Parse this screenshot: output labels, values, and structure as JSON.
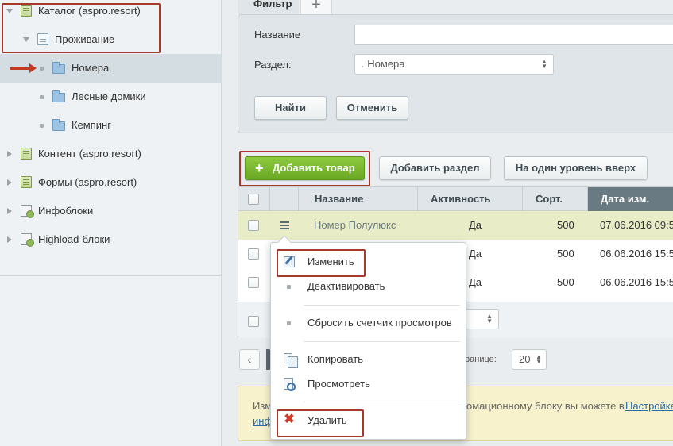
{
  "sidebar": {
    "items": [
      {
        "label": "Каталог (aspro.resort)"
      },
      {
        "label": "Проживание"
      },
      {
        "label": "Номера"
      },
      {
        "label": "Лесные домики"
      },
      {
        "label": "Кемпинг"
      },
      {
        "label": "Контент (aspro.resort)"
      },
      {
        "label": "Формы (aspro.resort)"
      },
      {
        "label": "Инфоблоки"
      },
      {
        "label": "Highload-блоки"
      }
    ]
  },
  "filter": {
    "tab_label": "Фильтр",
    "add_tab": "+",
    "name_label": "Название",
    "name_value": "",
    "section_label": "Раздел:",
    "section_value": ". Номера",
    "find_button": "Найти",
    "cancel_button": "Отменить"
  },
  "toolbar": {
    "add_product": "Добавить товар",
    "add_section": "Добавить раздел",
    "level_up": "На один уровень вверх"
  },
  "table": {
    "columns": [
      "Название",
      "Активность",
      "Сорт.",
      "Дата изм."
    ],
    "rows": [
      {
        "name": "Номер Полулюкс",
        "active": "Да",
        "sort": "500",
        "date": "07.06.2016 09:5"
      },
      {
        "name": "",
        "active": "Да",
        "sort": "500",
        "date": "06.06.2016 15:5"
      },
      {
        "name": "",
        "active": "Да",
        "sort": "500",
        "date": "06.06.2016 15:5"
      }
    ]
  },
  "pagination": {
    "prev": "‹",
    "per_page_label": "транице:",
    "per_page_value": "20"
  },
  "note": {
    "line1_start": "Изм",
    "line1_mid": "омационному блоку вы можете в",
    "line1_link": "Настройка",
    "line2_link": "инф"
  },
  "context_menu": {
    "items": [
      {
        "label": "Изменить",
        "icon": "edit-icon"
      },
      {
        "label": "Деактивировать",
        "icon": "bullet"
      },
      {
        "label": "Сбросить счетчик просмотров",
        "icon": "bullet"
      },
      {
        "label": "Копировать",
        "icon": "copy-icon"
      },
      {
        "label": "Просмотреть",
        "icon": "view-icon"
      },
      {
        "label": "Удалить",
        "icon": "delete-icon"
      }
    ]
  },
  "colors": {
    "accent_green": "#6aa824",
    "annotation_red": "#a8382a",
    "sorted_column": "#6a7a82",
    "row_highlight": "#e8edc7"
  }
}
